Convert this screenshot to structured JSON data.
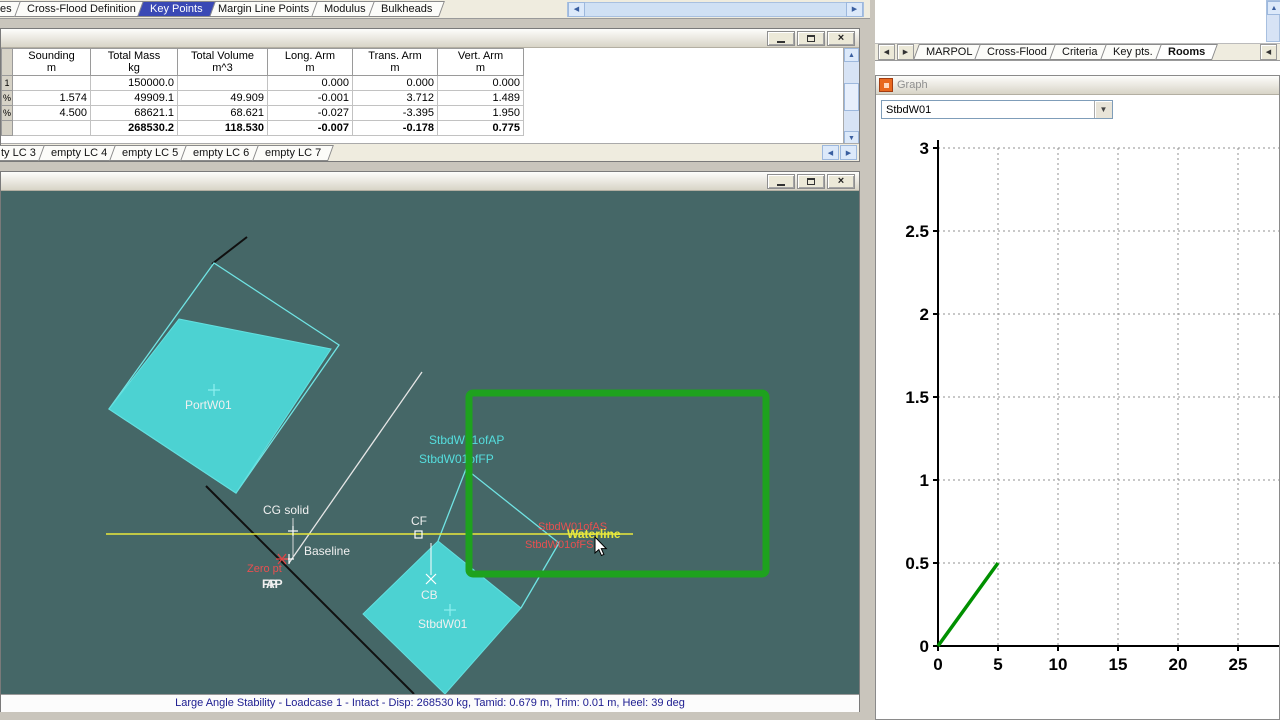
{
  "icons": {
    "close": "×",
    "arrow_left": "◀",
    "arrow_right": "▶",
    "arrow_up": "▲",
    "arrow_down": "▼"
  },
  "top_tab_strip": {
    "tabs": [
      {
        "label": "es",
        "selected": false
      },
      {
        "label": "Cross-Flood Definition",
        "selected": false
      },
      {
        "label": "Key Points",
        "selected": true
      },
      {
        "label": "Margin Line Points",
        "selected": false
      },
      {
        "label": "Modulus",
        "selected": false
      },
      {
        "label": "Bulkheads",
        "selected": false
      }
    ]
  },
  "table_window": {
    "columns": [
      {
        "title": "Sounding",
        "unit": "m"
      },
      {
        "title": "Total Mass",
        "unit": "kg"
      },
      {
        "title": "Total Volume",
        "unit": "m^3"
      },
      {
        "title": "Long. Arm",
        "unit": "m"
      },
      {
        "title": "Trans. Arm",
        "unit": "m"
      },
      {
        "title": "Vert. Arm",
        "unit": "m"
      }
    ],
    "rows": [
      {
        "header": "1",
        "cells": [
          "",
          "150000.0",
          "",
          "0.000",
          "0.000",
          "0.000"
        ]
      },
      {
        "header": "%",
        "cells": [
          "1.574",
          "49909.1",
          "49.909",
          "-0.001",
          "3.712",
          "1.489"
        ]
      },
      {
        "header": "%",
        "cells": [
          "4.500",
          "68621.1",
          "68.621",
          "-0.027",
          "-3.395",
          "1.950"
        ]
      }
    ],
    "total_row": {
      "cells": [
        "",
        "268530.2",
        "118.530",
        "-0.007",
        "-0.178",
        "0.775"
      ]
    },
    "bottom_tabs": [
      {
        "label": "ty LC 3",
        "selected": false
      },
      {
        "label": "empty LC 4",
        "selected": false
      },
      {
        "label": "empty LC 5",
        "selected": false
      },
      {
        "label": "empty LC 6",
        "selected": false
      },
      {
        "label": "empty LC 7",
        "selected": false
      }
    ]
  },
  "view_window": {
    "labels": {
      "port_tank": "PortW01",
      "stbd_tank": "StbdW01",
      "stbd_of_ap": "StbdW01ofAP",
      "stbd_of_fp": "StbdW01ofFP",
      "stbd_of_as": "StbdW01ofAS",
      "stbd_of_fs": "StbdW01ofFS",
      "cg": "CG solid",
      "cf": "CF",
      "cb": "CB",
      "baseline": "Baseline",
      "zero_pt": "Zero pt",
      "ap": "AP",
      "fp": "FP",
      "waterline": "Waterline"
    },
    "status_bar": "Large Angle Stability - Loadcase 1 - Intact - Disp: 268530 kg, Tamid: 0.679 m, Trim: 0.01 m, Heel: 39 deg"
  },
  "right_panel": {
    "tabs": [
      {
        "label": "MARPOL",
        "selected": false
      },
      {
        "label": "Cross-Flood",
        "selected": false
      },
      {
        "label": "Criteria",
        "selected": false
      },
      {
        "label": "Key pts.",
        "selected": false
      },
      {
        "label": "Rooms",
        "selected": true
      }
    ],
    "graph_window": {
      "title": "Graph",
      "selector_value": "StbdW01"
    }
  },
  "chart_data": {
    "type": "line",
    "title": "",
    "xlabel": "",
    "ylabel": "",
    "xlim": [
      0,
      28.5
    ],
    "ylim": [
      0,
      3
    ],
    "xticks": [
      0,
      5,
      10,
      15,
      20,
      25
    ],
    "yticks": [
      0,
      0.5,
      1,
      1.5,
      2,
      2.5,
      3
    ],
    "grid": "dashed",
    "legend": "none",
    "series": [
      {
        "name": "StbdW01",
        "color": "#009000",
        "points": [
          [
            0,
            0
          ],
          [
            5,
            0.5
          ]
        ]
      }
    ]
  },
  "colors": {
    "canvas_bg": "#456767",
    "tank_fill": "#4cd2d2",
    "tank_outline": "#70e4e4",
    "waterline_yellow": "#e9e93c",
    "highlight_green": "#1ea21e",
    "graph_line_green": "#009000",
    "selected_tab_blue": "#3a49b5"
  }
}
